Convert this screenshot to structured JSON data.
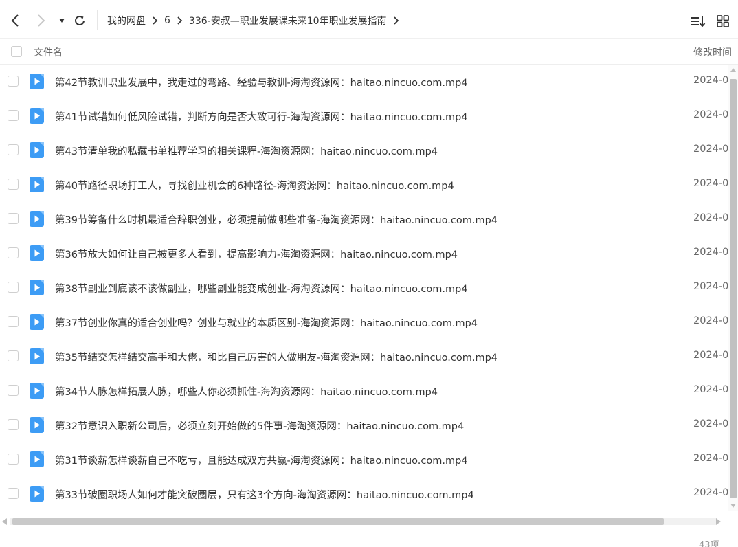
{
  "toolbar": {
    "breadcrumb": [
      "我的网盘",
      "6",
      "336-安叔—职业发展课未来10年职业发展指南"
    ]
  },
  "header": {
    "name_label": "文件名",
    "time_label": "修改时间"
  },
  "files": [
    {
      "name": "第42节教训职业发展中，我走过的弯路、经验与教训-海淘资源网：haitao.nincuo.com.mp4",
      "time": "2024-0"
    },
    {
      "name": "第41节试错如何低风险试错，判断方向是否大致可行-海淘资源网：haitao.nincuo.com.mp4",
      "time": "2024-0"
    },
    {
      "name": "第43节清单我的私藏书单推荐学习的相关课程-海淘资源网：haitao.nincuo.com.mp4",
      "time": "2024-0"
    },
    {
      "name": "第40节路径职场打工人，寻找创业机会的6种路径-海淘资源网：haitao.nincuo.com.mp4",
      "time": "2024-0"
    },
    {
      "name": "第39节筹备什么时机最适合辞职创业，必须提前做哪些准备-海淘资源网：haitao.nincuo.com.mp4",
      "time": "2024-0"
    },
    {
      "name": "第36节放大如何让自己被更多人看到，提高影响力-海淘资源网：haitao.nincuo.com.mp4",
      "time": "2024-0"
    },
    {
      "name": "第38节副业到底该不该做副业，哪些副业能变成创业-海淘资源网：haitao.nincuo.com.mp4",
      "time": "2024-0"
    },
    {
      "name": "第37节创业你真的适合创业吗？创业与就业的本质区别-海淘资源网：haitao.nincuo.com.mp4",
      "time": "2024-0"
    },
    {
      "name": "第35节结交怎样结交高手和大佬，和比自己厉害的人做朋友-海淘资源网：haitao.nincuo.com.mp4",
      "time": "2024-0"
    },
    {
      "name": "第34节人脉怎样拓展人脉，哪些人你必须抓住-海淘资源网：haitao.nincuo.com.mp4",
      "time": "2024-0"
    },
    {
      "name": "第32节意识入职新公司后，必须立刻开始做的5件事-海淘资源网：haitao.nincuo.com.mp4",
      "time": "2024-0"
    },
    {
      "name": "第31节谈薪怎样谈薪自己不吃亏，且能达成双方共赢-海淘资源网：haitao.nincuo.com.mp4",
      "time": "2024-0"
    },
    {
      "name": "第33节破圈职场人如何才能突破圈层，只有这3个方向-海淘资源网：haitao.nincuo.com.mp4",
      "time": "2024-0"
    }
  ],
  "footer": {
    "count": "43项"
  },
  "colors": {
    "icon_blue": "#3d9cf5",
    "text": "#333333",
    "muted": "#666666"
  }
}
